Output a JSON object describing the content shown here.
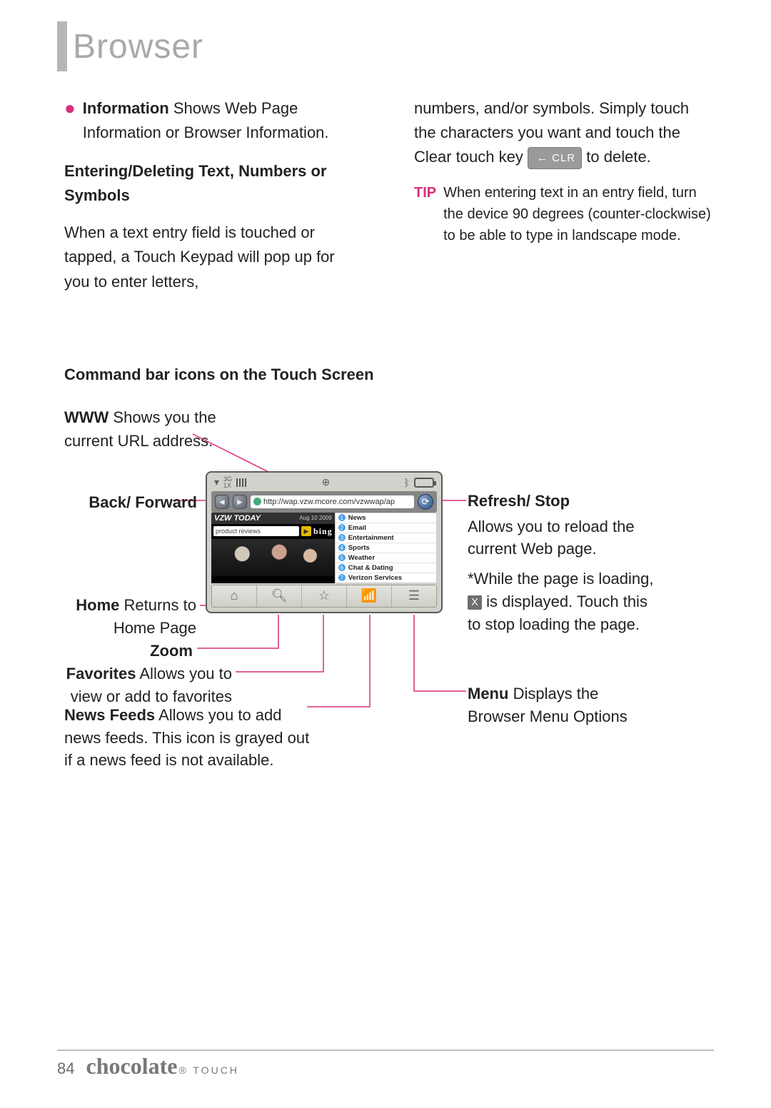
{
  "page": {
    "title": "Browser",
    "number": "84",
    "brand": "chocolate",
    "brand_sub": "TOUCH"
  },
  "col1": {
    "info_label": "Information",
    "info_text": " Shows Web Page Information or Browser Information.",
    "subhead": "Entering/Deleting Text, Numbers or Symbols",
    "body": "When a text entry field is touched or tapped, a Touch Keypad will pop up for you to enter letters,"
  },
  "col2": {
    "body1": "numbers, and/or symbols. Simply touch the characters you want and touch the Clear touch key ",
    "clr_chip": "← CLR",
    "body2": " to delete.",
    "tip_label": "TIP",
    "tip_text": "When entering text in an entry field, turn the device 90 degrees (counter-clockwise) to be able to type in landscape mode."
  },
  "section2": {
    "head": "Command bar icons on the Touch Screen",
    "www_label": "WWW",
    "www_text": " Shows you the current URL address.",
    "backfwd": "Back/ Forward",
    "home_label": "Home",
    "home_text": " Returns to Home Page",
    "zoom": "Zoom",
    "fav_label": "Favorites",
    "fav_text": " Allows you to view or add to favorites",
    "news_label": "News Feeds",
    "news_text": " Allows you to add news feeds. This icon is grayed out if a news feed is not available.",
    "refresh_label": "Refresh/ Stop",
    "refresh_text": "Allows you to reload the current Web page.",
    "refresh_note1": "*While the page is loading, ",
    "refresh_note2": " is displayed. Touch this to stop loading the page.",
    "x_glyph": "X",
    "menu_label": "Menu",
    "menu_text": " Displays the Browser Menu Options"
  },
  "phone": {
    "status_3g": "3G",
    "status_1x": "1X",
    "url": "http://wap.vzw.mcore.com/vzwwap/ap",
    "vzw": "VZW TODAY",
    "date": "Aug 10 2009",
    "search_placeholder": "product reviews",
    "bing": "bing",
    "links": [
      "News",
      "Email",
      "Entertainment",
      "Sports",
      "Weather",
      "Chat & Dating",
      "Verizon Services"
    ]
  }
}
